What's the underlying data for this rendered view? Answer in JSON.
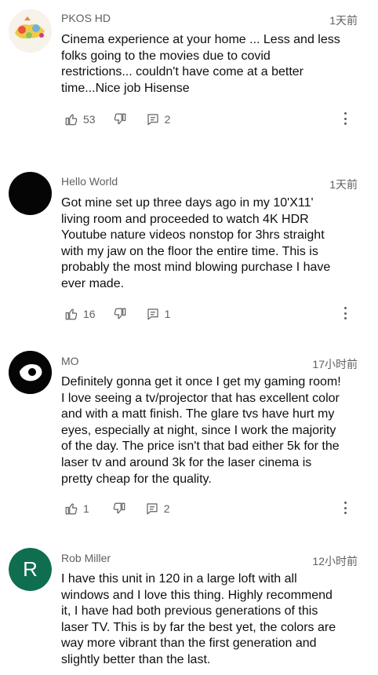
{
  "comments": [
    {
      "author": "PKOS HD",
      "time": "1天前",
      "avatar": "decorative-avatar",
      "text": [
        "Cinema experience at your home ... Less and less",
        "folks going to the movies due to covid",
        "restrictions... couldn't have come at a better",
        "time...Nice job Hisense"
      ],
      "likes": "53",
      "replies": "2"
    },
    {
      "author": "Hello World",
      "time": "1天前",
      "avatar": "black-avatar",
      "text": [
        "Got mine set up three days ago in my 10'X11'",
        "living room and proceeded to watch 4K HDR",
        "Youtube nature videos nonstop for 3hrs straight",
        "with my jaw on the floor the entire time. This is",
        "probably the most mind blowing purchase I have",
        "ever made."
      ],
      "likes": "16",
      "replies": "1"
    },
    {
      "author": "MO",
      "time": "17小时前",
      "avatar": "eye-avatar",
      "text": [
        "Definitely gonna get it once I get my gaming room!",
        "I love seeing a tv/projector that has excellent color",
        "and with a matt finish. The glare tvs have hurt my",
        "eyes, especially at night, since I work the majority",
        "of the day. The price isn't that bad either 5k for the",
        "laser tv and around 3k for the laser cinema is",
        "pretty cheap for the quality."
      ],
      "likes": "1",
      "replies": "2"
    },
    {
      "author": "Rob Miller",
      "time": "12小时前",
      "avatar_letter": "R",
      "avatar_color": "#0f6e4f",
      "text": [
        "I have this unit in 120 in a large loft with all",
        "windows and I love this thing.   Highly recommend",
        "it, I have had both previous generations of this",
        "laser TV.  This is by far the best yet, the colors are",
        "way more vibrant than the first generation and",
        "slightly better than the last."
      ]
    }
  ]
}
